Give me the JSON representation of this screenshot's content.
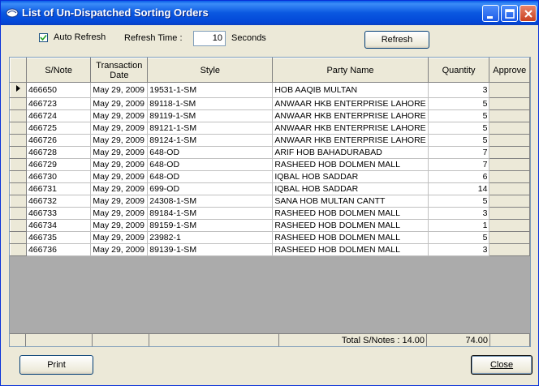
{
  "window": {
    "title": "List of Un-Dispatched Sorting Orders"
  },
  "toolbar": {
    "auto_refresh_label": "Auto Refresh",
    "auto_refresh_checked": true,
    "refresh_time_label": "Refresh Time :",
    "refresh_time_value": "10",
    "seconds_label": "Seconds",
    "refresh_button": "Refresh"
  },
  "grid": {
    "columns": [
      "S/Note",
      "Transaction Date",
      "Style",
      "Party Name",
      "Quantity",
      "Approve"
    ],
    "rows": [
      {
        "snote": "466650",
        "date": "May 29, 2009",
        "style": "19531-1-SM",
        "party": "HOB AAQIB MULTAN",
        "qty": "3"
      },
      {
        "snote": "466723",
        "date": "May 29, 2009",
        "style": "89118-1-SM",
        "party": "ANWAAR HKB ENTERPRISE LAHORE",
        "qty": "5"
      },
      {
        "snote": "466724",
        "date": "May 29, 2009",
        "style": "89119-1-SM",
        "party": "ANWAAR HKB ENTERPRISE LAHORE",
        "qty": "5"
      },
      {
        "snote": "466725",
        "date": "May 29, 2009",
        "style": "89121-1-SM",
        "party": "ANWAAR HKB ENTERPRISE LAHORE",
        "qty": "5"
      },
      {
        "snote": "466726",
        "date": "May 29, 2009",
        "style": "89124-1-SM",
        "party": "ANWAAR HKB ENTERPRISE LAHORE",
        "qty": "5"
      },
      {
        "snote": "466728",
        "date": "May 29, 2009",
        "style": "648-OD",
        "party": "ARIF HOB BAHADURABAD",
        "qty": "7"
      },
      {
        "snote": "466729",
        "date": "May 29, 2009",
        "style": "648-OD",
        "party": "RASHEED HOB DOLMEN MALL",
        "qty": "7"
      },
      {
        "snote": "466730",
        "date": "May 29, 2009",
        "style": "648-OD",
        "party": "IQBAL HOB SADDAR",
        "qty": "6"
      },
      {
        "snote": "466731",
        "date": "May 29, 2009",
        "style": "699-OD",
        "party": "IQBAL HOB SADDAR",
        "qty": "14"
      },
      {
        "snote": "466732",
        "date": "May 29, 2009",
        "style": "24308-1-SM",
        "party": "SANA HOB MULTAN CANTT",
        "qty": "5"
      },
      {
        "snote": "466733",
        "date": "May 29, 2009",
        "style": "89184-1-SM",
        "party": "RASHEED HOB DOLMEN MALL",
        "qty": "3"
      },
      {
        "snote": "466734",
        "date": "May 29, 2009",
        "style": "89159-1-SM",
        "party": "RASHEED HOB DOLMEN MALL",
        "qty": "1"
      },
      {
        "snote": "466735",
        "date": "May 29, 2009",
        "style": "23982-1",
        "party": "RASHEED HOB DOLMEN MALL",
        "qty": "5"
      },
      {
        "snote": "466736",
        "date": "May 29, 2009",
        "style": "89139-1-SM",
        "party": "RASHEED HOB DOLMEN MALL",
        "qty": "3"
      }
    ],
    "footer": {
      "total_label": "Total S/Notes : 14.00",
      "total_qty": "74.00"
    }
  },
  "buttons": {
    "print": "Print",
    "close": "Close"
  },
  "colors": {
    "titlebar": "#0a58e0",
    "face": "#ece9d8"
  }
}
